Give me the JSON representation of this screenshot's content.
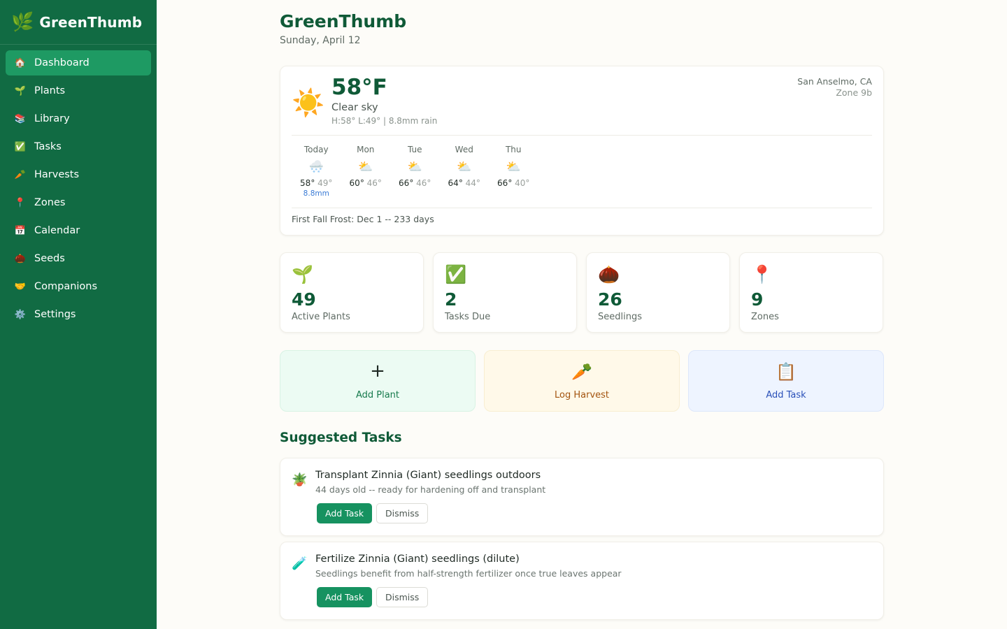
{
  "app": {
    "name": "GreenThumb",
    "logo_icon": "🌿"
  },
  "sidebar": {
    "items": [
      {
        "icon": "🏠",
        "label": "Dashboard",
        "active": true
      },
      {
        "icon": "🌱",
        "label": "Plants"
      },
      {
        "icon": "📚",
        "label": "Library"
      },
      {
        "icon": "✅",
        "label": "Tasks"
      },
      {
        "icon": "🥕",
        "label": "Harvests"
      },
      {
        "icon": "📍",
        "label": "Zones"
      },
      {
        "icon": "📅",
        "label": "Calendar"
      },
      {
        "icon": "🌰",
        "label": "Seeds"
      },
      {
        "icon": "🤝",
        "label": "Companions"
      },
      {
        "icon": "⚙️",
        "label": "Settings"
      }
    ]
  },
  "header": {
    "title": "GreenThumb",
    "date": "Sunday, April 12"
  },
  "weather": {
    "icon": "☀️",
    "temp": "58°F",
    "condition": "Clear sky",
    "detail": "H:58° L:49° | 8.8mm rain",
    "location": "San Anselmo, CA",
    "zone": "Zone 9b",
    "forecast": [
      {
        "day": "Today",
        "icon": "🌨️",
        "hi": "58°",
        "lo": "49°",
        "rain": "8.8mm"
      },
      {
        "day": "Mon",
        "icon": "⛅",
        "hi": "60°",
        "lo": "46°",
        "rain": ""
      },
      {
        "day": "Tue",
        "icon": "⛅",
        "hi": "66°",
        "lo": "46°",
        "rain": ""
      },
      {
        "day": "Wed",
        "icon": "⛅",
        "hi": "64°",
        "lo": "44°",
        "rain": ""
      },
      {
        "day": "Thu",
        "icon": "⛅",
        "hi": "66°",
        "lo": "40°",
        "rain": ""
      }
    ],
    "frost": "First Fall Frost: Dec 1 -- 233 days"
  },
  "stats": [
    {
      "icon": "🌱",
      "value": "49",
      "label": "Active Plants"
    },
    {
      "icon": "✅",
      "value": "2",
      "label": "Tasks Due"
    },
    {
      "icon": "🌰",
      "value": "26",
      "label": "Seedlings"
    },
    {
      "icon": "📍",
      "value": "9",
      "label": "Zones"
    }
  ],
  "actions": {
    "add_plant": {
      "icon": "+",
      "label": "Add Plant"
    },
    "log_harvest": {
      "icon": "🥕",
      "label": "Log Harvest"
    },
    "add_task": {
      "icon": "📋",
      "label": "Add Task"
    }
  },
  "suggested": {
    "title": "Suggested Tasks",
    "items": [
      {
        "icon": "🪴",
        "title": "Transplant Zinnia (Giant) seedlings outdoors",
        "subtitle": "44 days old -- ready for hardening off and transplant",
        "add_label": "Add Task",
        "dismiss_label": "Dismiss"
      },
      {
        "icon": "🧪",
        "title": "Fertilize Zinnia (Giant) seedlings (dilute)",
        "subtitle": "Seedlings benefit from half-strength fertilizer once true leaves appear",
        "add_label": "Add Task",
        "dismiss_label": "Dismiss"
      }
    ]
  },
  "colors": {
    "sidebar": "#116b43",
    "active_nav": "#1e9a63",
    "accent": "#169260",
    "title": "#0f5a37"
  }
}
